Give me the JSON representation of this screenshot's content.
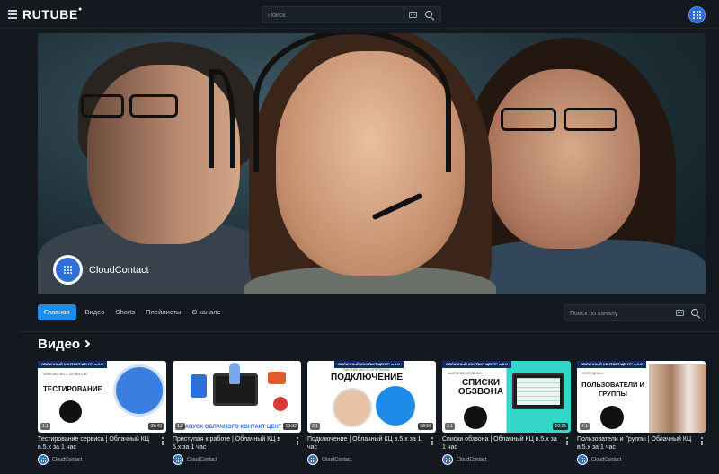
{
  "header": {
    "logo": "RUTUBE",
    "search_placeholder": "Поиск"
  },
  "banner": {
    "channel_name": "CloudContact"
  },
  "tabs": [
    {
      "label": "Главная",
      "active": true
    },
    {
      "label": "Видео"
    },
    {
      "label": "Shorts"
    },
    {
      "label": "Плейлисты"
    },
    {
      "label": "О канале"
    }
  ],
  "channel_search_placeholder": "Поиск по каналу",
  "section": {
    "title": "Видео"
  },
  "videos": [
    {
      "thumb_header": "ОБЛАЧНЫЙ КОНТАКТ ЦЕНТР в.5.Х",
      "thumb_sub": "ЗНАКОМСТВО С СЕРВИСОМ",
      "thumb_text": "ТЕСТИРОВАНИЕ",
      "episode": "1.1",
      "duration": "08:49",
      "title": "Тестирование сервиса | Облачный КЦ в.5.х за 1 час",
      "channel": "CloudContact"
    },
    {
      "thumb_text": "ЗАПУСК ОБЛАЧНОГО КОНТАКТ ЦЕНТ",
      "episode": "1.2",
      "duration": "10:32",
      "title": "Приступая к работе | Облачный КЦ в 5.х за 1 час",
      "channel": "CloudContact"
    },
    {
      "thumb_header": "ОБЛАЧНЫЙ КОНТАКТ ЦЕНТР в.5.Х",
      "thumb_sub": "РАБОЧЕЕ МЕСТО ОПЕРАТОРА",
      "thumb_text": "ПОДКЛЮЧЕНИЕ",
      "episode": "2.1",
      "duration": "08:56",
      "title": "Подключение | Облачный КЦ в.5.х за 1 час",
      "channel": "CloudContact"
    },
    {
      "thumb_header": "ОБЛАЧНЫЙ КОНТАКТ ЦЕНТР в.5.Х",
      "thumb_sub": "КАМПАНИИ ОБЗВОНА",
      "thumb_text": "СПИСКИ ОБЗВОНА",
      "episode": "3.1",
      "duration": "10:25",
      "title": "Списки обзвона | Облачный КЦ в.5.х за 1 час",
      "channel": "CloudContact"
    },
    {
      "thumb_header": "ОБЛАЧНЫЙ КОНТАКТ ЦЕНТР в.5.Х",
      "thumb_sub": "СОТРУДНИКИ",
      "thumb_text": "ПОЛЬЗОВАТЕЛИ И ГРУППЫ",
      "episode": "4.1",
      "title": "Пользователи и Группы | Облачный КЦ в.5.х за 1 час",
      "channel": "CloudContact"
    }
  ]
}
